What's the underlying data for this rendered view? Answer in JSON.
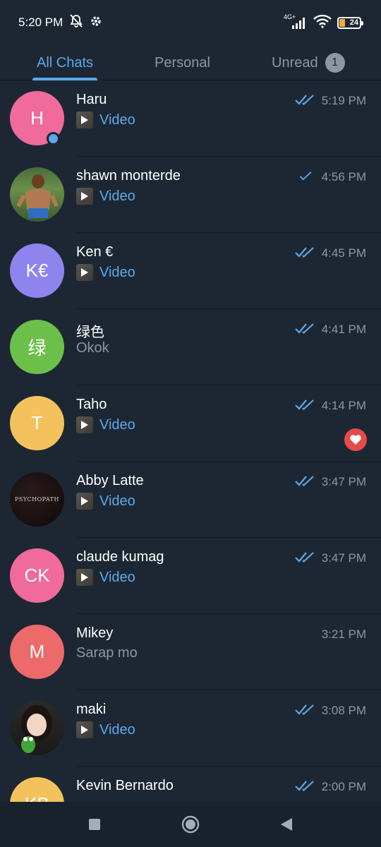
{
  "status_bar": {
    "time": "5:20 PM",
    "network": "4G+",
    "battery": "24"
  },
  "tabs": [
    {
      "label": "All Chats",
      "active": true
    },
    {
      "label": "Personal",
      "active": false
    },
    {
      "label": "Unread",
      "active": false,
      "badge": "1"
    }
  ],
  "chats": [
    {
      "name": "Haru",
      "time": "5:19 PM",
      "preview": "Video",
      "preview_type": "video",
      "avatar_initials": "H",
      "avatar_color": "#f06a9b",
      "avatar_type": "initials",
      "status": "read",
      "online": true
    },
    {
      "name": "shawn monterde",
      "time": "4:56 PM",
      "preview": "Video",
      "preview_type": "video",
      "avatar_type": "photo",
      "avatar_icon": "person-photo",
      "status": "sent"
    },
    {
      "name": "Ken €",
      "time": "4:45 PM",
      "preview": "Video",
      "preview_type": "video",
      "avatar_initials": "K€",
      "avatar_color": "#8f84ee",
      "avatar_type": "initials",
      "status": "read"
    },
    {
      "name": "绿色",
      "time": "4:41 PM",
      "preview": "Okok",
      "preview_type": "text",
      "avatar_initials": "绿",
      "avatar_color": "#6cc04a",
      "avatar_type": "initials",
      "status": "read"
    },
    {
      "name": "Taho",
      "time": "4:14 PM",
      "preview": "Video",
      "preview_type": "video",
      "avatar_initials": "T",
      "avatar_color": "#f4c25c",
      "avatar_type": "initials",
      "status": "read",
      "reaction": "heart"
    },
    {
      "name": "Abby Latte",
      "time": "3:47 PM",
      "preview": "Video",
      "preview_type": "video",
      "avatar_type": "photo",
      "avatar_icon": "dark-photo",
      "avatar_photo_text": "PSYCHOPATH",
      "status": "read"
    },
    {
      "name": "claude kumag",
      "time": "3:47 PM",
      "preview": "Video",
      "preview_type": "video",
      "avatar_initials": "CK",
      "avatar_color": "#f06a9b",
      "avatar_type": "initials",
      "status": "read"
    },
    {
      "name": "Mikey",
      "time": "3:21 PM",
      "preview": "Sarap mo",
      "preview_type": "text",
      "avatar_initials": "M",
      "avatar_color": "#ec6a6a",
      "avatar_type": "initials",
      "status": "none"
    },
    {
      "name": "maki",
      "time": "3:08 PM",
      "preview": "Video",
      "preview_type": "video",
      "avatar_type": "photo",
      "avatar_icon": "girl-photo",
      "status": "read"
    },
    {
      "name": "Kevin Bernardo",
      "time": "2:00 PM",
      "preview": "",
      "preview_type": "text",
      "avatar_initials": "KB",
      "avatar_color": "#f4c25c",
      "avatar_type": "initials",
      "status": "read"
    }
  ],
  "colors": {
    "background": "#1d2733",
    "accent": "#5ca8e9",
    "muted": "#8b97a4",
    "reaction": "#e74a4a"
  }
}
